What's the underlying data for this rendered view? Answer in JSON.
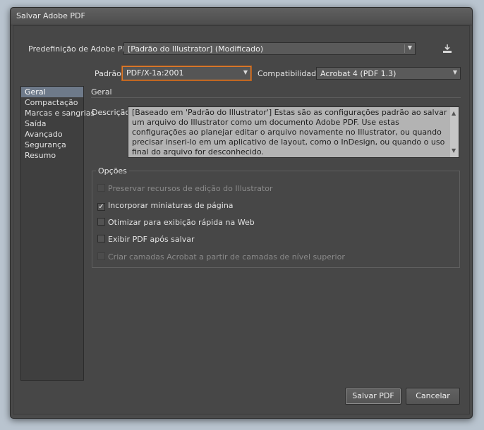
{
  "window": {
    "title": "Salvar Adobe PDF"
  },
  "preset": {
    "label": "Predefinição de Adobe PDF:",
    "value": "[Padrão do Illustrator] (Modificado)",
    "save_icon": "save-preset-icon"
  },
  "standard": {
    "label": "Padrão:",
    "value": "PDF/X-1a:2001"
  },
  "compatibility": {
    "label": "Compatibilidade:",
    "value": "Acrobat 4 (PDF 1.3)"
  },
  "sidebar": {
    "items": [
      {
        "label": "Geral",
        "selected": true
      },
      {
        "label": "Compactação"
      },
      {
        "label": "Marcas e sangrias"
      },
      {
        "label": "Saída"
      },
      {
        "label": "Avançado"
      },
      {
        "label": "Segurança"
      },
      {
        "label": "Resumo"
      }
    ]
  },
  "main": {
    "section_title": "Geral",
    "description_label": "Descrição:",
    "description_text": "[Baseado em 'Padrão do Illustrator'] Estas são as configurações padrão ao salvar um arquivo do Illustrator como um documento Adobe PDF. Use estas configurações ao planejar editar o arquivo novamente no Illustrator, ou quando precisar inseri-lo em um aplicativo de layout, como o InDesign, ou quando o uso final do arquivo for desconhecido.",
    "options_title": "Opções",
    "options": [
      {
        "label": "Preservar recursos de edição do Illustrator",
        "checked": false,
        "disabled": true
      },
      {
        "label": "Incorporar miniaturas de página",
        "checked": true,
        "disabled": false
      },
      {
        "label": "Otimizar para exibição rápida na Web",
        "checked": false,
        "disabled": false
      },
      {
        "label": "Exibir PDF após salvar",
        "checked": false,
        "disabled": false
      },
      {
        "label": "Criar camadas Acrobat a partir de camadas de nível superior",
        "checked": false,
        "disabled": true
      }
    ]
  },
  "buttons": {
    "save": "Salvar PDF",
    "cancel": "Cancelar"
  },
  "colors": {
    "focus_border": "#e07b2a",
    "selection": "#6e7a8a",
    "panel": "#474747"
  }
}
